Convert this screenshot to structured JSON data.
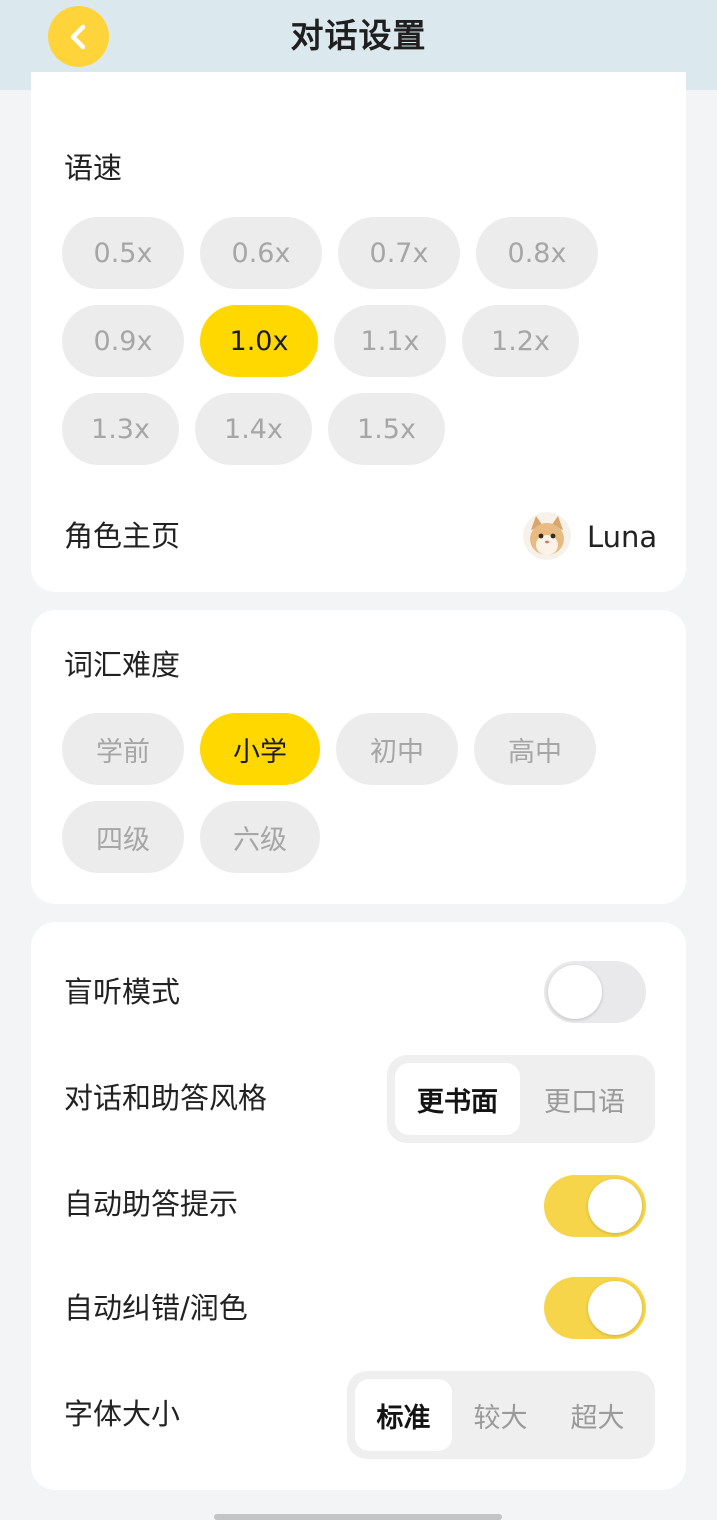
{
  "header": {
    "title": "对话设置",
    "back_icon": "chevron-left-icon"
  },
  "speed": {
    "label": "语速",
    "options": [
      "0.5x",
      "0.6x",
      "0.7x",
      "0.8x",
      "0.9x",
      "1.0x",
      "1.1x",
      "1.2x",
      "1.3x",
      "1.4x",
      "1.5x"
    ],
    "selected": "1.0x"
  },
  "role": {
    "label": "角色主页",
    "name": "Luna",
    "avatar_icon": "cat-avatar"
  },
  "vocab": {
    "label": "词汇难度",
    "options": [
      "学前",
      "小学",
      "初中",
      "高中",
      "四级",
      "六级"
    ],
    "selected": "小学"
  },
  "settings": {
    "blind_listening": {
      "label": "盲听模式",
      "on": false
    },
    "style": {
      "label": "对话和助答风格",
      "options": [
        "更书面",
        "更口语"
      ],
      "selected": "更书面"
    },
    "auto_hint": {
      "label": "自动助答提示",
      "on": true
    },
    "auto_correct": {
      "label": "自动纠错/润色",
      "on": true
    },
    "font_size": {
      "label": "字体大小",
      "options": [
        "标准",
        "较大",
        "超大"
      ],
      "selected": "标准"
    }
  },
  "colors": {
    "accent": "#FFD800",
    "header_bg": "#DBE8EE",
    "toggle_on": "#F7D54A"
  }
}
